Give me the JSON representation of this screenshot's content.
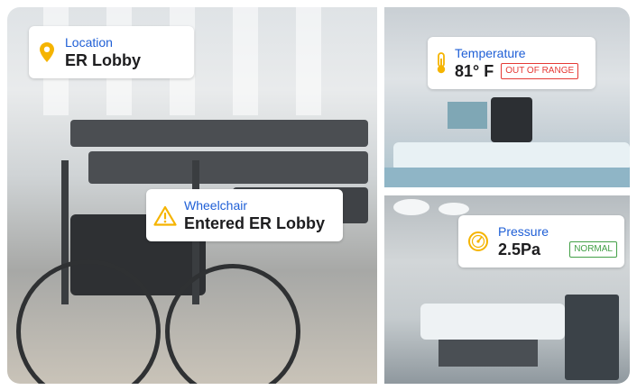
{
  "colors": {
    "label_blue": "#1f5fd6",
    "icon_yellow": "#f5b400",
    "out_of_range_red": "#e53935",
    "normal_green": "#43a047"
  },
  "cards": {
    "location": {
      "label": "Location",
      "value": "ER Lobby",
      "icon": "location-pin-icon"
    },
    "wheelchair": {
      "label": "Wheelchair",
      "value": "Entered ER Lobby",
      "icon": "warning-icon"
    },
    "temperature": {
      "label": "Temperature",
      "value": "81° F",
      "status": "OUT OF RANGE",
      "icon": "thermometer-icon"
    },
    "pressure": {
      "label": "Pressure",
      "value": "2.5Pa",
      "status": "NORMAL",
      "icon": "gauge-icon"
    }
  }
}
